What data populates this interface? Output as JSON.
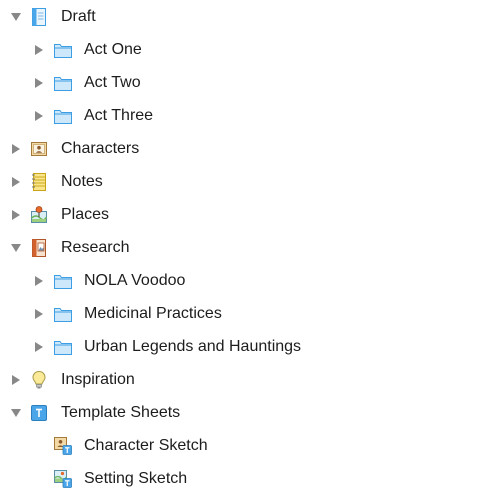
{
  "binder": {
    "draft": {
      "label": "Draft",
      "icon": "draft-document-icon",
      "expanded": true,
      "children": [
        {
          "label": "Act One",
          "icon": "folder-icon",
          "expanded": false
        },
        {
          "label": "Act Two",
          "icon": "folder-icon",
          "expanded": false
        },
        {
          "label": "Act Three",
          "icon": "folder-icon",
          "expanded": false
        }
      ]
    },
    "characters": {
      "label": "Characters",
      "icon": "character-card-icon",
      "expanded": false
    },
    "notes": {
      "label": "Notes",
      "icon": "notepad-icon",
      "expanded": false
    },
    "places": {
      "label": "Places",
      "icon": "map-pin-icon",
      "expanded": false
    },
    "research": {
      "label": "Research",
      "icon": "research-book-icon",
      "expanded": true,
      "children": [
        {
          "label": "NOLA Voodoo",
          "icon": "folder-icon",
          "expanded": false
        },
        {
          "label": "Medicinal Practices",
          "icon": "folder-icon",
          "expanded": false
        },
        {
          "label": "Urban Legends and Hauntings",
          "icon": "folder-icon",
          "expanded": false
        }
      ]
    },
    "inspiration": {
      "label": "Inspiration",
      "icon": "lightbulb-icon",
      "expanded": false
    },
    "template_sheets": {
      "label": "Template Sheets",
      "icon": "template-sheets-icon",
      "expanded": true,
      "children": [
        {
          "label": "Character Sketch",
          "icon": "character-sketch-icon"
        },
        {
          "label": "Setting Sketch",
          "icon": "setting-sketch-icon"
        }
      ]
    }
  },
  "colors": {
    "folder_fill": "#cde8fb",
    "folder_stroke": "#3e9ee3",
    "triangle": "#888888",
    "text": "#1d1d1d"
  }
}
